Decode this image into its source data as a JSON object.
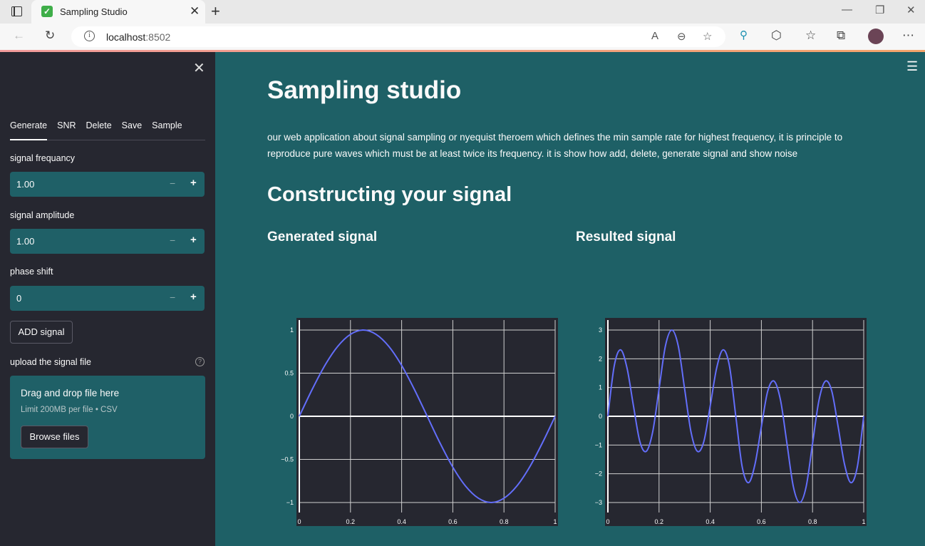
{
  "browser": {
    "tab_title": "Sampling Studio",
    "url_host": "localhost",
    "url_port": ":8502"
  },
  "sidebar": {
    "tabs": [
      "Generate",
      "SNR",
      "Delete",
      "Save",
      "Sample"
    ],
    "frequency_label": "signal frequancy",
    "frequency_value": "1.00",
    "amplitude_label": "signal amplitude",
    "amplitude_value": "1.00",
    "phase_label": "phase shift",
    "phase_value": "0",
    "add_button": "ADD signal",
    "upload_label": "upload the signal file",
    "dropzone_title": "Drag and drop file here",
    "dropzone_limit": "Limit 200MB per file • CSV",
    "browse_button": "Browse files"
  },
  "main": {
    "title": "Sampling studio",
    "intro": "our web application about signal sampling or nyequist theroem which defines the min sample rate for highest frequency, it is principle to reproduce pure waves which must be at least twice its frequency. it is show how add, delete, generate signal and show noise",
    "section_title": "Constructing your signal",
    "generated_title": "Generated signal",
    "resulted_title": "Resulted signal"
  },
  "chart_data": [
    {
      "type": "line",
      "title": "Generated signal",
      "xlim": [
        0,
        1
      ],
      "ylim": [
        -1,
        1
      ],
      "x_ticks": [
        "0",
        "0.2",
        "0.4",
        "0.6",
        "0.8",
        "1"
      ],
      "y_ticks": [
        "1",
        "0.5",
        "0",
        "−0.5",
        "−1"
      ],
      "series": [
        {
          "color": "#636efa",
          "x": [
            0,
            0.05,
            0.1,
            0.15,
            0.2,
            0.25,
            0.3,
            0.35,
            0.4,
            0.45,
            0.5,
            0.55,
            0.6,
            0.65,
            0.7,
            0.75,
            0.8,
            0.85,
            0.9,
            0.95,
            1
          ],
          "y": [
            0,
            0.31,
            0.59,
            0.81,
            0.95,
            1,
            0.95,
            0.81,
            0.59,
            0.31,
            0,
            -0.31,
            -0.59,
            -0.81,
            -0.95,
            -1,
            -0.95,
            -0.81,
            -0.59,
            -0.31,
            0
          ]
        }
      ],
      "grid": true
    },
    {
      "type": "line",
      "title": "Resulted signal",
      "xlim": [
        0,
        1
      ],
      "ylim": [
        -3,
        3
      ],
      "x_ticks": [
        "0",
        "0.2",
        "0.4",
        "0.6",
        "0.8",
        "1"
      ],
      "y_ticks": [
        "3",
        "2",
        "1",
        "0",
        "−1",
        "−2",
        "−3"
      ],
      "series": [
        {
          "color": "#636efa",
          "x": [
            0,
            0.025,
            0.05,
            0.075,
            0.1,
            0.125,
            0.15,
            0.175,
            0.2,
            0.225,
            0.25,
            0.275,
            0.3,
            0.325,
            0.35,
            0.375,
            0.4,
            0.425,
            0.45,
            0.475,
            0.5,
            0.525,
            0.55,
            0.575,
            0.6,
            0.625,
            0.65,
            0.675,
            0.7,
            0.725,
            0.75,
            0.775,
            0.8,
            0.825,
            0.85,
            0.875,
            0.9,
            0.925,
            0.95,
            0.975,
            1
          ],
          "y": [
            0,
            1.76,
            2.31,
            1.67,
            0.36,
            -0.88,
            -1.22,
            -0.55,
            0.95,
            2.45,
            3.0,
            2.45,
            0.95,
            -0.55,
            -1.22,
            -0.88,
            0.36,
            1.67,
            2.31,
            1.76,
            0,
            -1.76,
            -2.31,
            -1.67,
            -0.36,
            0.88,
            1.22,
            0.55,
            -0.95,
            -2.45,
            -3.0,
            -2.45,
            -0.95,
            0.55,
            1.22,
            0.88,
            -0.36,
            -1.67,
            -2.31,
            -1.76,
            0
          ]
        }
      ],
      "grid": true
    }
  ]
}
